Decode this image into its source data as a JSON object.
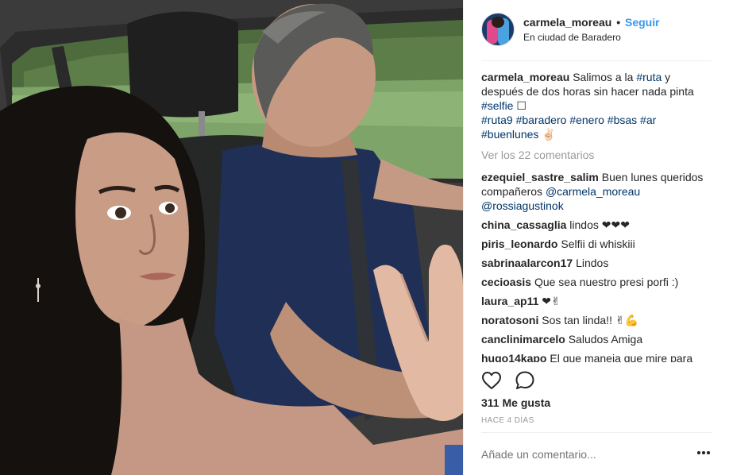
{
  "header": {
    "username": "carmela_moreau",
    "separator": "•",
    "follow_label": "Seguir",
    "location": "En ciudad de Baradero"
  },
  "caption": {
    "username": "carmela_moreau",
    "text_1": "Salimos a la",
    "tag_1": "#ruta",
    "text_2": "y después de dos horas sin hacer nada pinta",
    "tag_2": "#selfie",
    "box_glyph": "☐",
    "tags": [
      "#ruta9",
      "#baradero",
      "#enero",
      "#bsas",
      "#ar",
      "#buenlunes"
    ],
    "emoji": "✌🏻"
  },
  "view_all": "Ver los 22 comentarios",
  "comments": [
    {
      "user": "ezequiel_sastre_salim",
      "text": "Buen lunes queridos compañeros",
      "mentions": "@carmela_moreau @rossiagustinok"
    },
    {
      "user": "china_cassaglia",
      "text": "lindos ❤❤❤",
      "mentions": ""
    },
    {
      "user": "piris_leonardo",
      "text": "Selfii di whiskiii",
      "mentions": ""
    },
    {
      "user": "sabrinaalarcon17",
      "text": "Lindos",
      "mentions": ""
    },
    {
      "user": "cecioasis",
      "text": "Que sea nuestro presi porfi :)",
      "mentions": ""
    },
    {
      "user": "laura_ap11",
      "text": "❤✌",
      "mentions": ""
    },
    {
      "user": "noratosoni",
      "text": "Sos tan linda!! ✌💪",
      "mentions": ""
    },
    {
      "user": "canclinimarcelo",
      "text": "Saludos Amiga",
      "mentions": ""
    },
    {
      "user": "hugo14kapo",
      "text": "El que maneja que mire para",
      "mentions": ""
    }
  ],
  "actions": {
    "like_icon": "heart-icon",
    "comment_icon": "comment-icon"
  },
  "likes": "311 Me gusta",
  "time": "HACE 4 DÍAS",
  "add_comment_placeholder": "Añade un comentario...",
  "colors": {
    "link_blue": "#3897f0",
    "hashtag": "#003569",
    "muted": "#999999",
    "text": "#262626"
  }
}
